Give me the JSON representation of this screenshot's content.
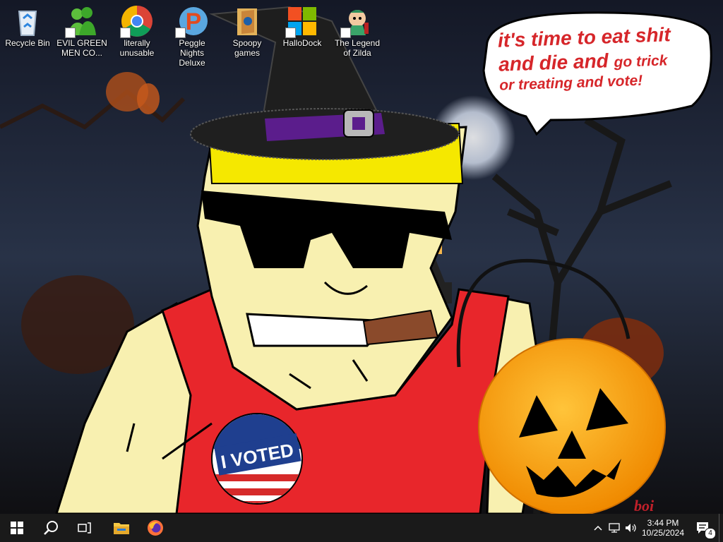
{
  "desktop_icons": [
    {
      "label": "Recycle Bin",
      "icon": "recycle-bin-icon"
    },
    {
      "label": "EVIL GREEN MEN CO...",
      "icon": "green-men-icon"
    },
    {
      "label": "literally unusable",
      "icon": "chrome-icon"
    },
    {
      "label": "Peggle Nights Deluxe",
      "icon": "peggle-icon"
    },
    {
      "label": "Spoopy games",
      "icon": "folder-icon"
    },
    {
      "label": "HalloDock",
      "icon": "windows-logo-icon"
    },
    {
      "label": "The Legend of Zilda",
      "icon": "zilda-icon"
    }
  ],
  "wallpaper": {
    "speech_line1": "it's time to eat shit",
    "speech_line2": "and die and",
    "speech_line3": "go trick",
    "speech_line4": "or treating and vote!",
    "badge_text": "I VOTED",
    "signature": "boi"
  },
  "taskbar": {
    "start": "windows-start-icon",
    "search": "search-icon",
    "taskview": "task-view-icon",
    "pinned": [
      "file-explorer-icon",
      "firefox-icon"
    ],
    "time": "3:44 PM",
    "date": "10/25/2024",
    "notification_count": "4"
  },
  "colors": {
    "taskbar": "#1a1a1a",
    "speech_red": "#d6262a",
    "tank_top": "#e8262b",
    "skin": "#f8f0b0"
  }
}
